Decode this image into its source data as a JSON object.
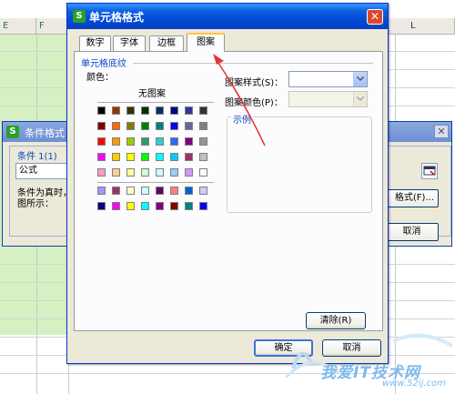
{
  "sheet": {
    "columns": [
      "E",
      "F",
      "L"
    ]
  },
  "cond_dialog": {
    "title": "条件格式",
    "condition_label": "条件 1(1)",
    "condition_type": "公式",
    "description": "条件为真时，图所示：",
    "format_button": "格式(F)...",
    "cancel_button": "取消"
  },
  "dialog": {
    "title": "单元格格式",
    "close_glyph": "✕",
    "tabs": [
      "数字",
      "字体",
      "边框",
      "图案"
    ],
    "active_tab": "图案",
    "shading_legend": "单元格底纹",
    "color_label": "颜色：",
    "no_pattern": "无图案",
    "pattern_style_label": "图案样式(S)：",
    "pattern_style_value": "",
    "pattern_color_label": "图案颜色(P)：",
    "pattern_color_value": "",
    "sample_legend": "示例",
    "clear_button": "清除(R)",
    "ok_button": "确定",
    "cancel_button": "取消"
  },
  "palette": {
    "main_rows": [
      [
        "#000000",
        "#993300",
        "#333300",
        "#003300",
        "#003366",
        "#000080",
        "#333399",
        "#333333"
      ],
      [
        "#800000",
        "#FF6600",
        "#808000",
        "#008000",
        "#008080",
        "#0000FF",
        "#666699",
        "#808080"
      ],
      [
        "#FF0000",
        "#FF9900",
        "#99CC00",
        "#339966",
        "#33CCCC",
        "#3366FF",
        "#800080",
        "#969696"
      ],
      [
        "#FF00FF",
        "#FFCC00",
        "#FFFF00",
        "#00FF00",
        "#00FFFF",
        "#00CCFF",
        "#993366",
        "#C0C0C0"
      ],
      [
        "#FF99CC",
        "#FFCC99",
        "#FFFF99",
        "#CCFFCC",
        "#CCFFFF",
        "#99CCFF",
        "#CC99FF",
        "#FFFFFF"
      ]
    ],
    "extra_rows": [
      [
        "#9999FF",
        "#993366",
        "#FFFFCC",
        "#CCFFFF",
        "#660066",
        "#FF8080",
        "#0066CC",
        "#CCCCFF"
      ],
      [
        "#000080",
        "#FF00FF",
        "#FFFF00",
        "#00FFFF",
        "#800080",
        "#800000",
        "#008080",
        "#0000FF"
      ]
    ]
  },
  "watermark": {
    "text": "我爱IT技术网",
    "url": "www.52ij.com"
  },
  "colors": {
    "title_blue": "#0148d4",
    "accent_label": "#0a45c5",
    "annotation_red": "#e8322c"
  }
}
